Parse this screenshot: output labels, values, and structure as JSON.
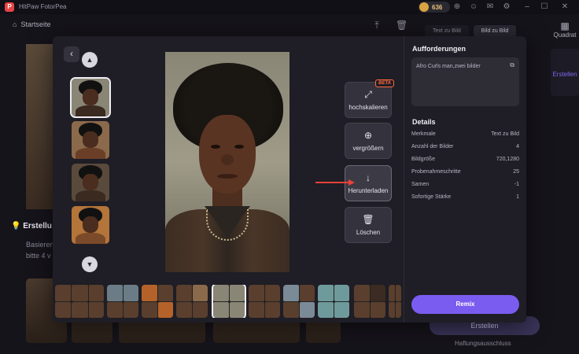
{
  "app": {
    "title": "HitPaw FotorPea",
    "coins": "636"
  },
  "background": {
    "nav_home": "Startseite",
    "tabs": [
      "Text zu Bild",
      "Bild zu Bild"
    ],
    "quadrat_label": "Quadrat",
    "right_side_label": "Erstellen",
    "section_title": "Erstellu",
    "section_text1": "Basieren",
    "section_text2": "bitte 4 v",
    "erstellen_button": "Erstellen",
    "haftung": "Haftungsausschluss"
  },
  "modal": {
    "actions": {
      "upscale": {
        "label": "hochskalieren",
        "badge": "BETA",
        "icon": "upscale-icon"
      },
      "zoom": {
        "label": "vergrößern",
        "icon": "zoom-in-icon"
      },
      "download": {
        "label": "Herunterladen",
        "icon": "download-icon"
      },
      "delete": {
        "label": "Löschen",
        "icon": "trash-icon"
      }
    },
    "annotation": {
      "color": "#e8423a"
    },
    "right_panel": {
      "requirements_title": "Aufforderungen",
      "prompt": "Afro Curls man,zwei bilder",
      "details_title": "Details",
      "details": [
        {
          "key": "Merkmale",
          "value": "Text zu Bild"
        },
        {
          "key": "Anzahl der Bilder",
          "value": "4"
        },
        {
          "key": "Bildgröße",
          "value": "720,1280"
        },
        {
          "key": "Probenahmeschritte",
          "value": "25"
        },
        {
          "key": "Samen",
          "value": "-1"
        },
        {
          "key": "Sofortige Stärke",
          "value": "1"
        }
      ],
      "remix_label": "Remix"
    },
    "accent_color": "#7a5cf0"
  }
}
